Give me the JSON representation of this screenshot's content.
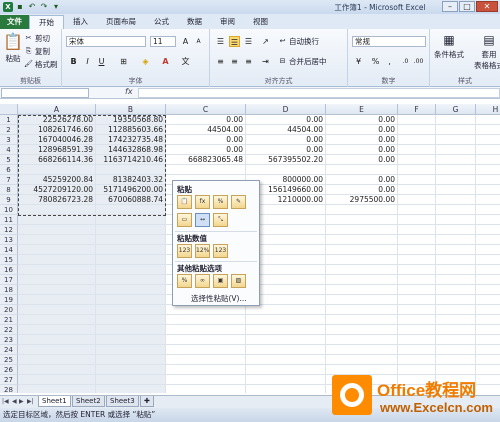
{
  "window": {
    "title": "工作簿1 - Microsoft Excel"
  },
  "qat": {
    "icons": [
      "excel-logo",
      "save-icon",
      "undo-icon",
      "redo-icon"
    ]
  },
  "tabs": [
    "文件",
    "开始",
    "插入",
    "页面布局",
    "公式",
    "数据",
    "审阅",
    "视图"
  ],
  "ribbon": {
    "clipboard": {
      "label": "剪贴板",
      "paste": "粘贴",
      "cut": "剪切",
      "copy": "复制",
      "format_painter": "格式刷"
    },
    "font": {
      "label": "字体",
      "font_name": "宋体",
      "font_size": "11",
      "bold": "B",
      "italic": "I",
      "underline": "U"
    },
    "alignment": {
      "label": "对齐方式",
      "wrap": "自动换行",
      "merge": "合并后居中"
    },
    "number": {
      "label": "数字",
      "format": "常规",
      "percent": "%",
      "comma": ","
    },
    "styles": {
      "label": "样式",
      "conditional": "条件格式",
      "table": "套用\n表格格式"
    }
  },
  "formula_bar": {
    "fx": "fx",
    "value": ""
  },
  "columns": [
    "A",
    "B",
    "C",
    "D",
    "E",
    "F",
    "G",
    "H"
  ],
  "rows": [
    "1",
    "2",
    "3",
    "4",
    "5",
    "6",
    "7",
    "8",
    "9",
    "10",
    "11",
    "12",
    "13",
    "14",
    "15",
    "16",
    "17",
    "18",
    "19",
    "20",
    "21",
    "22",
    "23",
    "24",
    "25",
    "26",
    "27",
    "28"
  ],
  "cells": {
    "r1": [
      "22526278.00",
      "19350568.80",
      "0.00",
      "0.00",
      "0.00"
    ],
    "r2": [
      "108261746.60",
      "112885603.66",
      "44504.00",
      "44504.00",
      "0.00"
    ],
    "r3": [
      "167040046.28",
      "174232735.48",
      "0.00",
      "0.00",
      "0.00"
    ],
    "r4": [
      "128968591.39",
      "144632868.98",
      "0.00",
      "0.00",
      "0.00"
    ],
    "r5": [
      "668266114.36",
      "1163714210.46",
      "668823065.48",
      "567395502.20",
      "0.00"
    ],
    "r6": [
      "",
      "",
      "",
      "",
      ""
    ],
    "r7": [
      "45259200.84",
      "81382403.32",
      "",
      "800000.00",
      "0.00"
    ],
    "r8": [
      "4527209120.00",
      "5171496200.00",
      "",
      "156149660.00",
      "0.00"
    ],
    "r9": [
      "780826723.28",
      "670060888.74",
      "",
      "1210000.00",
      "2975500.00"
    ]
  },
  "context_menu": {
    "paste_title": "粘贴",
    "paste_values_title": "粘贴数值",
    "other_paste_title": "其他粘贴选项",
    "paste_special": "选择性粘贴(V)..."
  },
  "sheets": [
    "Sheet1",
    "Sheet2",
    "Sheet3"
  ],
  "status": "选定目标区域，然后按 ENTER 或选择 “粘贴”",
  "watermark": {
    "line1": "Office教程网",
    "line2": "www.Excelcn.com"
  }
}
